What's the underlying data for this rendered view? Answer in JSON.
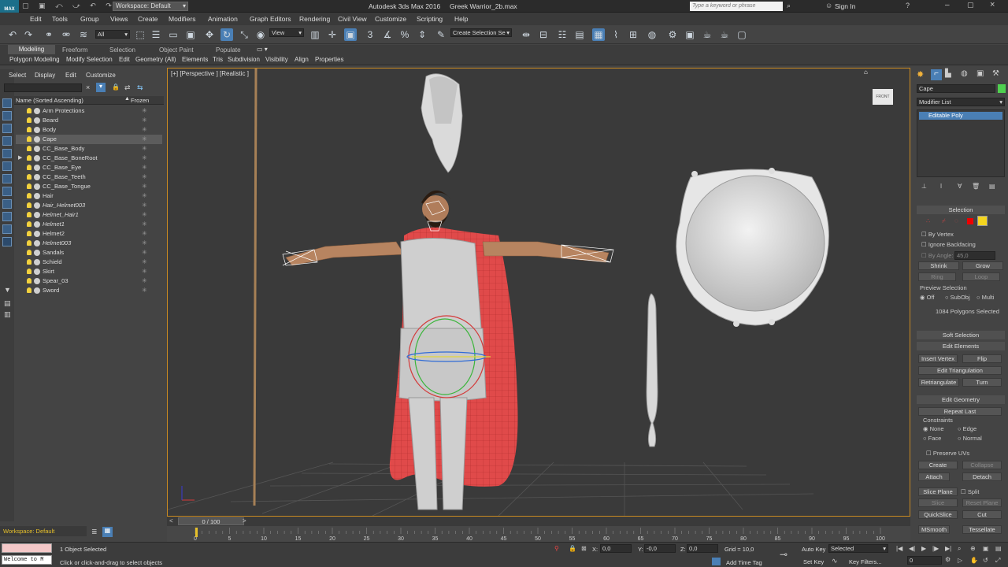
{
  "title_bar": {
    "logo": "MAX",
    "workspace": "Workspace: Default",
    "app_title": "Autodesk 3ds Max 2016",
    "file_name": "Greek Warrior_2b.max",
    "search_placeholder": "Type a keyword or phrase",
    "sign_in": "Sign In"
  },
  "menu": [
    "Edit",
    "Tools",
    "Group",
    "Views",
    "Create",
    "Modifiers",
    "Animation",
    "Graph Editors",
    "Rendering",
    "Civil View",
    "Customize",
    "Scripting",
    "Help"
  ],
  "toolbar": {
    "selection_filter": "All",
    "ref_coord": "View",
    "named_selection": "Create Selection Se"
  },
  "ribbon": {
    "tabs": [
      "Modeling",
      "Freeform",
      "Selection",
      "Object Paint",
      "Populate"
    ],
    "items": [
      "Polygon Modeling",
      "Modify Selection",
      "Edit",
      "Geometry (All)",
      "Elements",
      "Tris",
      "Subdivision",
      "Visibility",
      "Align",
      "Properties"
    ]
  },
  "scene_explorer": {
    "menu": [
      "Select",
      "Display",
      "Edit",
      "Customize"
    ],
    "col_name": "Name (Sorted Ascending)",
    "col_frozen": "Frozen",
    "rows": [
      "Arm Protections",
      "Beard",
      "Body",
      "Cape",
      "CC_Base_Body",
      "CC_Base_BoneRoot",
      "CC_Base_Eye",
      "CC_Base_Teeth",
      "CC_Base_Tongue",
      "Hair",
      "Hair_Helmet003",
      "Helmet_Hair1",
      "Helmet1",
      "Helmet2",
      "Helmet003",
      "Sandals",
      "Schield",
      "Skirt",
      "Spear_03",
      "Sword"
    ],
    "selected": "Cape",
    "frozen_icon": "snowflake-icon"
  },
  "viewport": {
    "label": "[+] [Perspective ] [Realistic ]",
    "viewcube": "FRONT"
  },
  "command_panel": {
    "object_name": "Cape",
    "object_color": "#4fd04f",
    "modifier_list": "Modifier List",
    "stack_item": "Editable Poly",
    "selection": {
      "header": "Selection",
      "by_vertex": "By Vertex",
      "ignore_backfacing": "Ignore Backfacing",
      "by_angle": "By Angle:",
      "angle_value": "45,0",
      "shrink": "Shrink",
      "grow": "Grow",
      "ring": "Ring",
      "loop": "Loop",
      "preview": "Preview Selection",
      "preview_off": "Off",
      "preview_subobj": "SubObj",
      "preview_multi": "Multi",
      "count": "1084 Polygons Selected"
    },
    "soft_selection": "Soft Selection",
    "edit_elements": {
      "header": "Edit Elements",
      "insert_vertex": "Insert Vertex",
      "flip": "Flip",
      "edit_triangulation": "Edit Triangulation",
      "retriangulate": "Retriangulate",
      "turn": "Turn"
    },
    "edit_geometry": {
      "header": "Edit Geometry",
      "repeat_last": "Repeat Last",
      "constraints": "Constraints",
      "none": "None",
      "edge": "Edge",
      "face": "Face",
      "normal": "Normal",
      "preserve_uvs": "Preserve UVs",
      "create": "Create",
      "collapse": "Collapse",
      "attach": "Attach",
      "detach": "Detach",
      "slice_plane": "Slice Plane",
      "split": "Split",
      "slice": "Slice",
      "reset_plane": "Reset Plane",
      "quickslice": "QuickSlice",
      "cut": "Cut",
      "msmooth": "MSmooth",
      "tessellate": "Tessellate"
    }
  },
  "timeline": {
    "frame_label": "0 / 100",
    "ticks": [
      "0",
      "5",
      "10",
      "15",
      "20",
      "25",
      "30",
      "35",
      "40",
      "45",
      "50",
      "55",
      "60",
      "65",
      "70",
      "75",
      "80",
      "85",
      "90",
      "95",
      "100"
    ]
  },
  "status": {
    "workspace": "Workspace: Default",
    "maxscript": "Welcome to M",
    "selected": "1 Object Selected",
    "prompt": "Click or click-and-drag to select objects",
    "x_label": "X:",
    "x_value": "0,0",
    "y_label": "Y:",
    "y_value": "-0,0",
    "z_label": "Z:",
    "z_value": "0,0",
    "grid": "Grid = 10,0",
    "add_time_tag": "Add Time Tag",
    "auto_key": "Auto Key",
    "auto_key_mode": "Selected",
    "set_key": "Set Key",
    "key_filters": "Key Filters...",
    "current_frame": "0"
  }
}
